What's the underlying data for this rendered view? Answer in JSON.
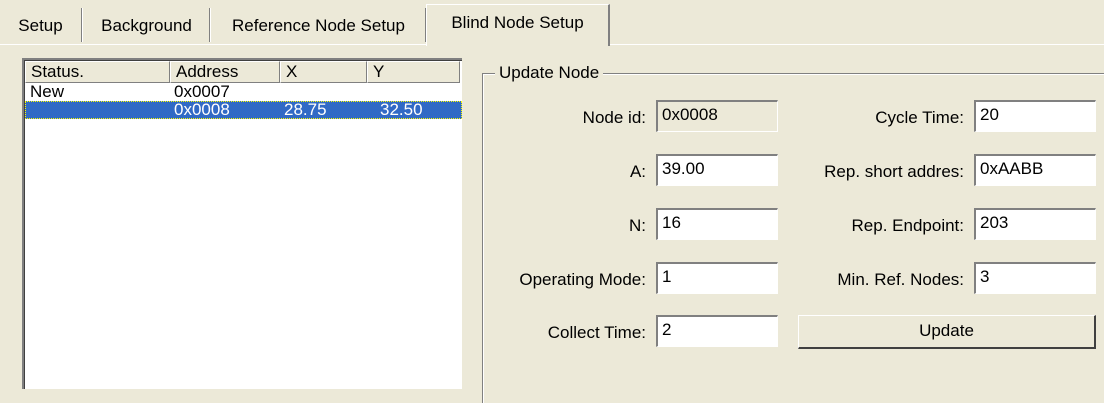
{
  "tabs": [
    {
      "label": "Setup"
    },
    {
      "label": "Background"
    },
    {
      "label": "Reference Node Setup"
    },
    {
      "label": "Blind Node Setup"
    }
  ],
  "list": {
    "columns": [
      "Status.",
      "Address",
      "X",
      "Y"
    ],
    "rows": [
      {
        "status": "New",
        "address": "0x0007",
        "x": "",
        "y": "",
        "selected": false
      },
      {
        "status": "",
        "address": "0x0008",
        "x": "28.75",
        "y": "32.50",
        "selected": true
      }
    ]
  },
  "group": {
    "title": "Update Node",
    "fields": {
      "node_id": {
        "label": "Node id:",
        "value": "0x0008"
      },
      "a": {
        "label": "A:",
        "value": "39.00"
      },
      "n": {
        "label": "N:",
        "value": "16"
      },
      "operating_mode": {
        "label": "Operating Mode:",
        "value": "1"
      },
      "collect_time": {
        "label": "Collect Time:",
        "value": "2"
      },
      "cycle_time": {
        "label": "Cycle Time:",
        "value": "20"
      },
      "rep_short_addr": {
        "label": "Rep. short addres:",
        "value": "0xAABB"
      },
      "rep_endpoint": {
        "label": "Rep. Endpoint:",
        "value": "203"
      },
      "min_ref_nodes": {
        "label": "Min. Ref. Nodes:",
        "value": "3"
      }
    },
    "update_label": "Update"
  }
}
